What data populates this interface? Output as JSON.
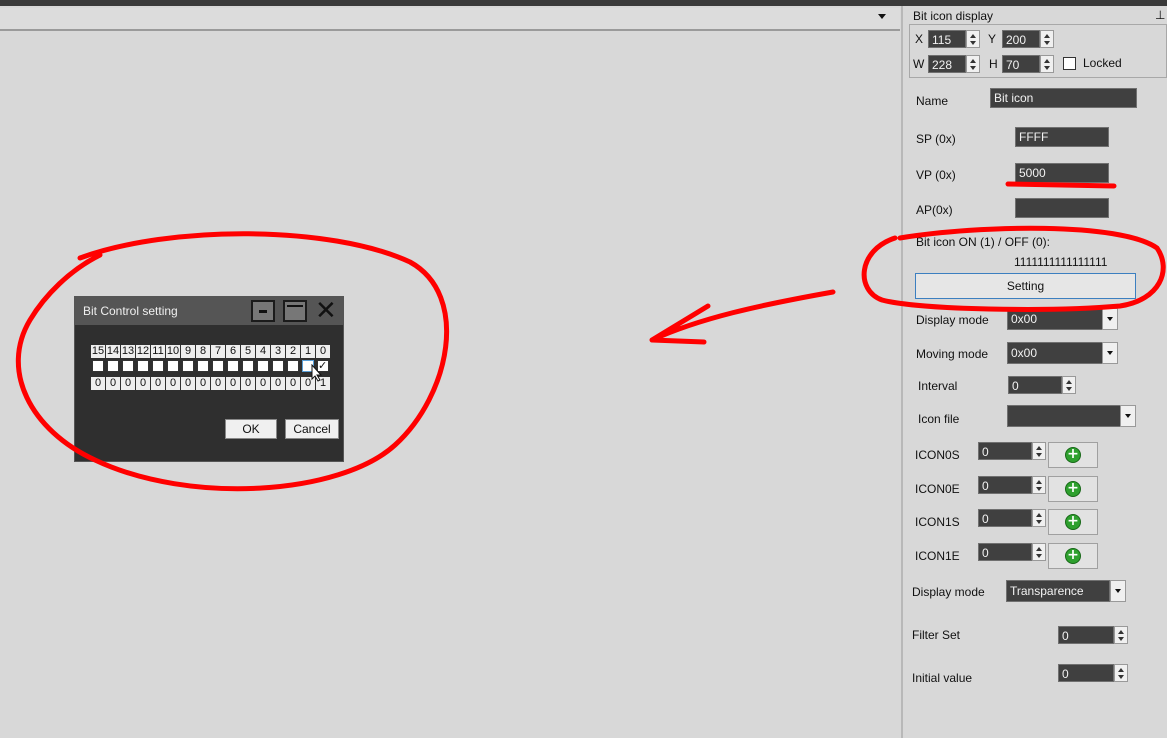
{
  "canvas": {
    "strip_dropdown_icon": "chevron-down-icon"
  },
  "dialog": {
    "title": "Bit Control setting",
    "bit_labels": [
      "15",
      "14",
      "13",
      "12",
      "11",
      "10",
      "9",
      "8",
      "7",
      "6",
      "5",
      "4",
      "3",
      "2",
      "1",
      "0"
    ],
    "bit_values": [
      "0",
      "0",
      "0",
      "0",
      "0",
      "0",
      "0",
      "0",
      "0",
      "0",
      "0",
      "0",
      "0",
      "0",
      "0",
      "1"
    ],
    "checked_bits": [
      "0"
    ],
    "ok_label": "OK",
    "cancel_label": "Cancel"
  },
  "panel": {
    "title": "Bit icon display",
    "geometry": {
      "x_label": "X",
      "x_value": "115",
      "y_label": "Y",
      "y_value": "200",
      "w_label": "W",
      "w_value": "228",
      "h_label": "H",
      "h_value": "70",
      "locked_label": "Locked"
    },
    "name_label": "Name",
    "name_value": "Bit icon",
    "sp_label": "SP (0x)",
    "sp_value": "FFFF",
    "vp_label": "VP (0x)",
    "vp_value": "5000",
    "ap_label": "AP(0x)",
    "ap_value": "",
    "bit_icon_label": "Bit icon ON (1) / OFF (0):",
    "bit_icon_value": "1111111111111111",
    "setting_label": "Setting",
    "display_mode_label": "Display mode",
    "display_mode_value": "0x00",
    "moving_mode_label": "Moving mode",
    "moving_mode_value": "0x00",
    "interval_label": "Interval",
    "interval_value": "0",
    "icon_file_label": "Icon file",
    "icon_file_value": "",
    "icons": [
      {
        "label": "ICON0S",
        "value": "0"
      },
      {
        "label": "ICON0E",
        "value": "0"
      },
      {
        "label": "ICON1S",
        "value": "0"
      },
      {
        "label": "ICON1E",
        "value": "0"
      }
    ],
    "display_mode2_label": "Display mode",
    "display_mode2_value": "Transparence",
    "filter_set_label": "Filter Set",
    "filter_set_value": "0",
    "initial_value_label": "Initial value",
    "initial_value_value": "0"
  },
  "colors": {
    "annotation": "#ff0000",
    "panel_bg": "#d8d8d8",
    "dialog_bg": "#2f2f2f",
    "field_bg": "#404040",
    "add_icon": "#2ea02e"
  }
}
